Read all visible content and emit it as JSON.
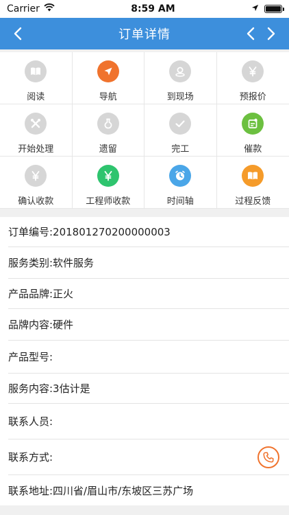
{
  "status_bar": {
    "carrier": "Carrier",
    "time": "8:59 AM",
    "battery_level": 1.0
  },
  "nav": {
    "title": "订单详情",
    "bar_color": "#3d8fdc"
  },
  "actions": [
    {
      "label": "阅读",
      "icon": "book-icon",
      "color": "#d6d6d6"
    },
    {
      "label": "导航",
      "icon": "navigation-arrow-icon",
      "color": "#f0732d"
    },
    {
      "label": "到现场",
      "icon": "location-pin-icon",
      "color": "#d6d6d6"
    },
    {
      "label": "预报价",
      "icon": "yen-icon",
      "color": "#d6d6d6"
    },
    {
      "label": "开始处理",
      "icon": "tools-icon",
      "color": "#d6d6d6"
    },
    {
      "label": "遗留",
      "icon": "flask-icon",
      "color": "#d6d6d6"
    },
    {
      "label": "完工",
      "icon": "checkmark-icon",
      "color": "#d6d6d6"
    },
    {
      "label": "催款",
      "icon": "reminder-icon",
      "color": "#6cc040"
    },
    {
      "label": "确认收款",
      "icon": "yen-icon",
      "color": "#d6d6d6"
    },
    {
      "label": "工程师收款",
      "icon": "yen-icon",
      "color": "#2ec46e"
    },
    {
      "label": "时间轴",
      "icon": "clock-icon",
      "color": "#4aa6e8"
    },
    {
      "label": "过程反馈",
      "icon": "book-icon",
      "color": "#f59b2a"
    }
  ],
  "details": [
    {
      "key": "order_no",
      "text": "订单编号:201801270200000003"
    },
    {
      "key": "service_type",
      "text": "服务类别:软件服务"
    },
    {
      "key": "brand",
      "text": "产品品牌:正火"
    },
    {
      "key": "brand_content",
      "text": "品牌内容:硬件"
    },
    {
      "key": "model",
      "text": "产品型号:"
    },
    {
      "key": "service_content",
      "text": "服务内容:3估计是"
    },
    {
      "key": "contact_person",
      "text": "联系人员:"
    },
    {
      "key": "contact_method",
      "text": "联系方式:",
      "action_icon": "phone-icon"
    },
    {
      "key": "address",
      "text": "联系地址:四川省/眉山市/东坡区三苏广场"
    }
  ],
  "colors": {
    "accent_orange": "#f0732d"
  }
}
